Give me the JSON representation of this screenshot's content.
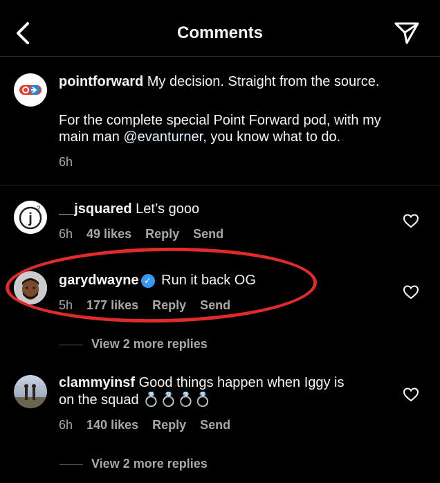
{
  "header": {
    "title": "Comments"
  },
  "caption": {
    "username": "pointforward",
    "text1": " My decision. Straight from the source.",
    "text2": "For the complete special Point Forward pod, with my",
    "text3": "main man ",
    "mention": "@evanturner",
    "text4": ", you know what to do.",
    "time": "6h"
  },
  "comments": [
    {
      "username": "__jsquared",
      "text": " Let’s gooo",
      "time": "6h",
      "likes": "49 likes",
      "reply": "Reply",
      "send": "Send"
    },
    {
      "username": "garydwayne",
      "text": " Run it back OG",
      "time": "5h",
      "likes": "177 likes",
      "reply": "Reply",
      "send": "Send",
      "more_replies": "View 2 more replies"
    },
    {
      "username": "clammyinsf",
      "text": " Good things happen when Iggy is",
      "text2": "on the squad ",
      "emoji": "💍💍💍💍",
      "time": "6h",
      "likes": "140 likes",
      "reply": "Reply",
      "send": "Send",
      "more_replies": "View 2 more replies"
    }
  ],
  "colors": {
    "highlight": "#e02b2b",
    "verified": "#3897f0",
    "background": "#000000"
  }
}
